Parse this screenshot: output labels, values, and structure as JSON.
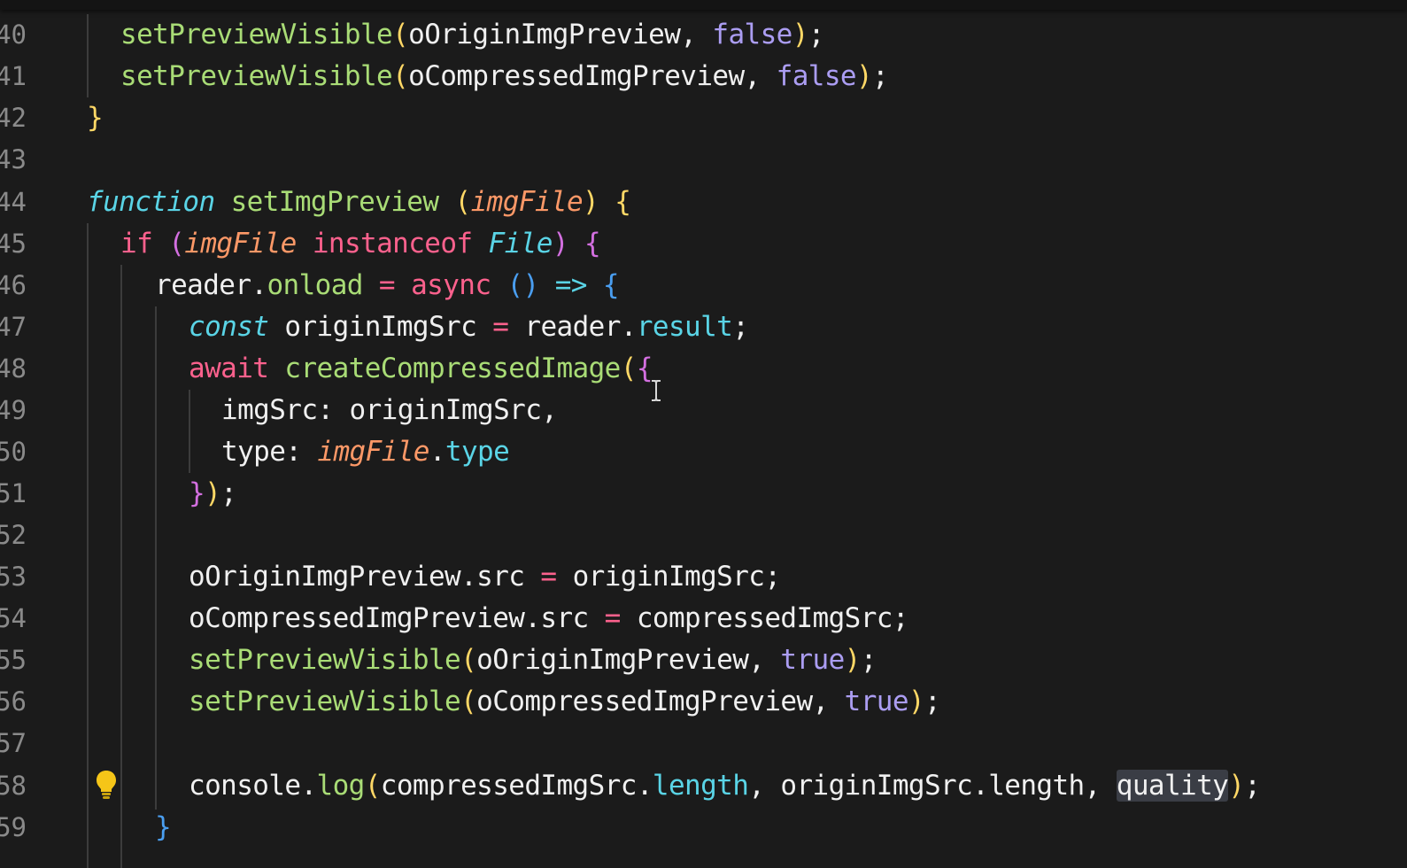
{
  "editor": {
    "line_numbers": [
      "40",
      "41",
      "42",
      "43",
      "44",
      "45",
      "46",
      "47",
      "48",
      "49",
      "50",
      "51",
      "52",
      "53",
      "54",
      "55",
      "56",
      "57",
      "58",
      "59"
    ]
  },
  "code": {
    "l40": {
      "fn": "setPreviewVisible",
      "open": "(",
      "arg": "oOriginImgPreview, ",
      "bool": "false",
      "close": ")",
      "end": ";"
    },
    "l41": {
      "fn": "setPreviewVisible",
      "open": "(",
      "arg": "oCompressedImgPreview, ",
      "bool": "false",
      "close": ")",
      "end": ";"
    },
    "l42": {
      "brace": "}"
    },
    "l44": {
      "kw": "function",
      "name": "setImgPreview",
      "open": "(",
      "param": "imgFile",
      "close": ")",
      "brace": "{"
    },
    "l45": {
      "kw": "if",
      "open": "(",
      "param": "imgFile",
      "op": "instanceof",
      "cls": "File",
      "close": ")",
      "brace": "{"
    },
    "l46": {
      "obj": "reader.",
      "prop": "onload",
      "eq": "=",
      "kw": "async",
      "paren": "()",
      "arrow": "=>",
      "brace": "{"
    },
    "l47": {
      "kw": "const",
      "name": "originImgSrc",
      "eq": "=",
      "obj": "reader.",
      "prop": "result",
      "end": ";"
    },
    "l48": {
      "kw": "await",
      "fn": "createCompressedImage",
      "open": "(",
      "brace": "{"
    },
    "l49": {
      "text": "imgSrc: originImgSrc,"
    },
    "l50": {
      "key": "type: ",
      "param": "imgFile",
      "dot": ".",
      "prop": "type"
    },
    "l51": {
      "brace": "}",
      "close": ")",
      "end": ";"
    },
    "l53": {
      "lhs": "oOriginImgPreview.src",
      "eq": "=",
      "rhs": "originImgSrc;"
    },
    "l54": {
      "lhs": "oCompressedImgPreview.src",
      "eq": "=",
      "rhs": "compressedImgSrc;"
    },
    "l55": {
      "fn": "setPreviewVisible",
      "open": "(",
      "arg": "oOriginImgPreview, ",
      "bool": "true",
      "close": ")",
      "end": ";"
    },
    "l56": {
      "fn": "setPreviewVisible",
      "open": "(",
      "arg": "oCompressedImgPreview, ",
      "bool": "true",
      "close": ")",
      "end": ";"
    },
    "l58": {
      "obj": "console.",
      "fn": "log",
      "open": "(",
      "a1": "compressedImgSrc.",
      "a1prop": "length",
      "a2": ", originImgSrc.length, ",
      "a3": "quality",
      "close": ")",
      "end": ";"
    },
    "l59": {
      "brace": "}"
    }
  },
  "icons": {
    "lightbulb": "lightbulb-icon",
    "text_cursor": "text-cursor-icon"
  },
  "colors": {
    "background": "#1b1b1b",
    "keyword": "#fc618d",
    "function": "#a9dc76",
    "storage": "#5ad4e6",
    "parameter": "#fc9867",
    "boolean": "#ab9df2",
    "lightbulb": "#f5c518"
  }
}
